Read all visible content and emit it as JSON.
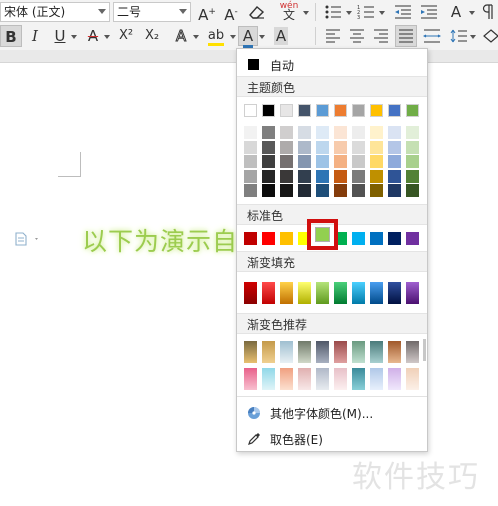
{
  "toolbar": {
    "font_family": "宋体 (正文)",
    "font_size": "二号",
    "increase_font_icon": "A⁺",
    "decrease_font_icon": "A⁻",
    "pinyin_icon_text": "wén",
    "bold": "B",
    "italic": "I",
    "underline": "U",
    "strikethrough": "A",
    "superscript": "X²",
    "subscript": "X₂",
    "font_color_icon": "A",
    "char_shading_icon": "A",
    "text_effect_icon": "A",
    "highlight_icon": "ab",
    "accent_color": "#2e75b6"
  },
  "document": {
    "body_text": "以下为演示自",
    "watermark": "软件技巧"
  },
  "color_panel": {
    "auto_label": "自动",
    "auto_color": "#000000",
    "theme_title": "主题颜色",
    "theme_top": [
      "#ffffff",
      "#000000",
      "#e7e6e6",
      "#44546a",
      "#5b9bd5",
      "#ed7d31",
      "#a5a5a5",
      "#ffc000",
      "#4472c4",
      "#70ad47"
    ],
    "theme_shades": [
      [
        "#f2f2f2",
        "#7f7f7f",
        "#d0cece",
        "#d6dce4",
        "#deeaf6",
        "#fbe5d5",
        "#ededed",
        "#fff2cc",
        "#dae3f3",
        "#e2efd9"
      ],
      [
        "#d8d8d8",
        "#595959",
        "#aeabab",
        "#adb9ca",
        "#bdd7ee",
        "#f7cbac",
        "#dbdbdb",
        "#fee599",
        "#b4c6e7",
        "#c5e0b3"
      ],
      [
        "#bfbfbf",
        "#3f3f3f",
        "#757070",
        "#8496b0",
        "#9dc3e6",
        "#f4b183",
        "#c9c9c9",
        "#ffd966",
        "#8eaadb",
        "#a8d08d"
      ],
      [
        "#a5a5a5",
        "#262626",
        "#3a3838",
        "#323f4f",
        "#2e75b5",
        "#c55a11",
        "#7b7b7b",
        "#bf9000",
        "#2f5496",
        "#538135"
      ],
      [
        "#7f7f7f",
        "#0c0c0c",
        "#171616",
        "#222a35",
        "#1e4e79",
        "#843c0b",
        "#525252",
        "#7f6000",
        "#1f3864",
        "#375623"
      ]
    ],
    "standard_title": "标准色",
    "standard": [
      "#c00000",
      "#ff0000",
      "#ffc000",
      "#ffff00",
      "#92d050",
      "#00b050",
      "#00b0f0",
      "#0070c0",
      "#002060",
      "#7030a0"
    ],
    "selected_color": "#92d050",
    "gradient_fill_title": "渐变填充",
    "gradient_fill": [
      [
        "#d00000",
        "#8a0000"
      ],
      [
        "#ff4a4a",
        "#c00000"
      ],
      [
        "#ffd24a",
        "#c07000"
      ],
      [
        "#ffff70",
        "#b0b000"
      ],
      [
        "#b5e37a",
        "#5f9a1e"
      ],
      [
        "#4ad07a",
        "#007a30"
      ],
      [
        "#4ad0ff",
        "#007aa8"
      ],
      [
        "#4a9ef0",
        "#004a8a"
      ],
      [
        "#3050a0",
        "#001040"
      ],
      [
        "#a060d0",
        "#4a1070"
      ]
    ],
    "gradient_rec_title": "渐变色推荐",
    "gradient_rec_row1": [
      [
        "#7a6a40",
        "#e8c070"
      ],
      [
        "#c49a4a",
        "#f0d090"
      ],
      [
        "#9fbfd0",
        "#e8f0f4"
      ],
      [
        "#707a6a",
        "#d0d8c8"
      ],
      [
        "#505868",
        "#a8b0c0"
      ],
      [
        "#9a4a4a",
        "#e0a0a0"
      ],
      [
        "#6a9a80",
        "#c0e0d0"
      ],
      [
        "#4a7a7a",
        "#a8d0d0"
      ],
      [
        "#a0582a",
        "#e8b890"
      ],
      [
        "#706a6a",
        "#d0c8c8"
      ]
    ],
    "gradient_rec_row2": [
      [
        "#e8608a",
        "#f8c0d0"
      ],
      [
        "#90d8e8",
        "#e0f4f8"
      ],
      [
        "#f0a080",
        "#fce0d0"
      ],
      [
        "#e0b0b0",
        "#f8e8e8"
      ],
      [
        "#b0b8c8",
        "#e8ecf0"
      ],
      [
        "#e8c0c8",
        "#fcf0f0"
      ],
      [
        "#3a8a9a",
        "#8ad0d8"
      ],
      [
        "#b0c8e8",
        "#e8f0fc"
      ],
      [
        "#d0b0e8",
        "#f0e8fc"
      ],
      [
        "#f0d0b8",
        "#fcf0e8"
      ]
    ],
    "more_colors_label": "其他字体颜色(M)...",
    "eyedropper_label": "取色器(E)"
  }
}
